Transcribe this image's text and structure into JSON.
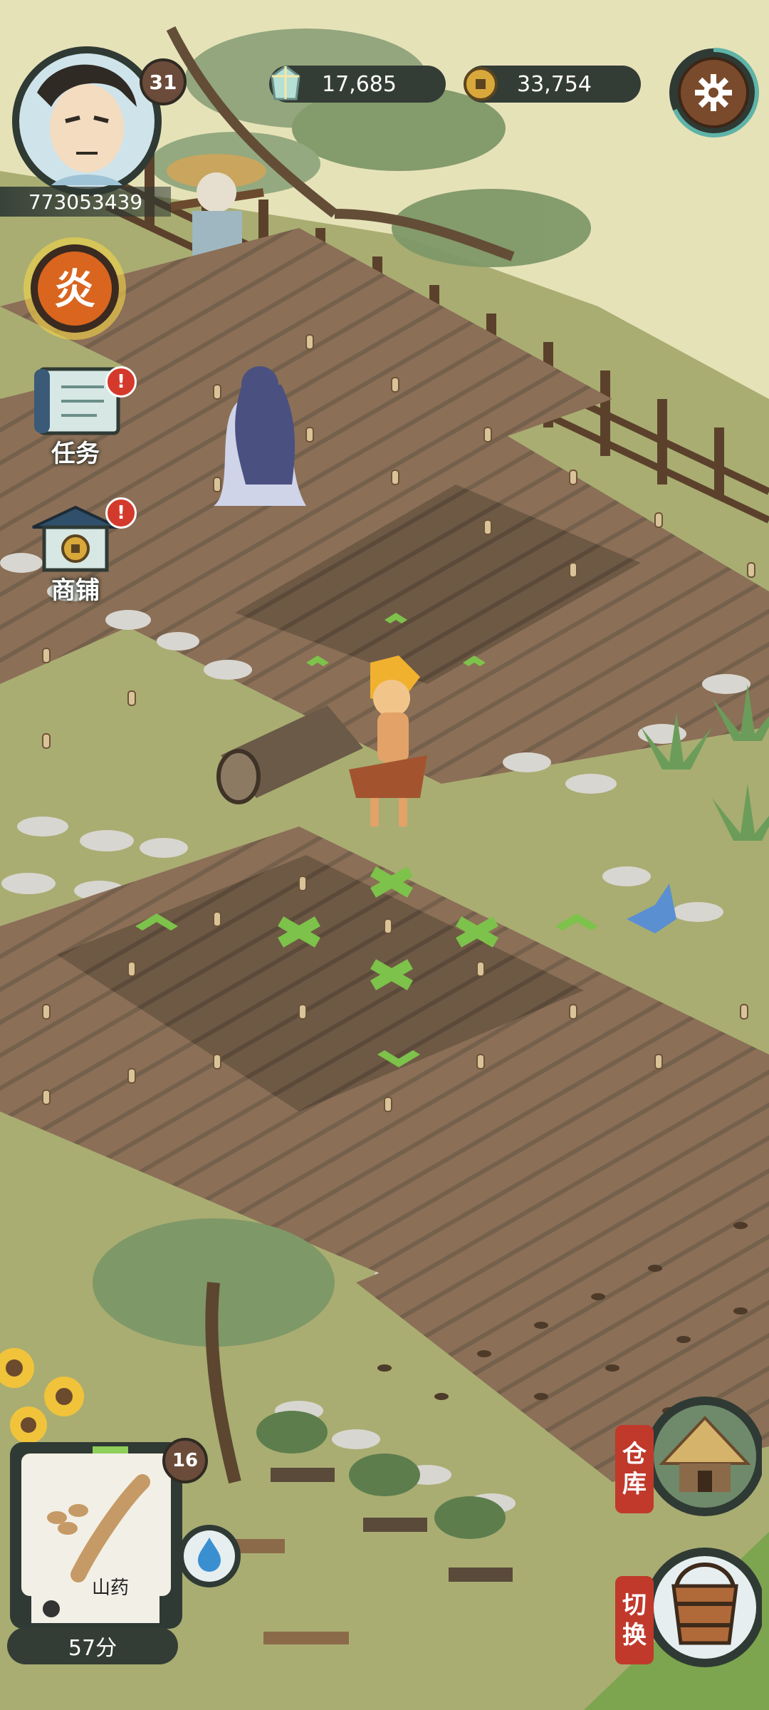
{
  "player": {
    "id": "773053439",
    "level": "31"
  },
  "currency": {
    "gems": "17,685",
    "coins": "33,754"
  },
  "skill": {
    "glyph": "炎"
  },
  "side_menu": {
    "quests": "任务",
    "shop": "商铺",
    "notice": "!"
  },
  "seed": {
    "name": "山药",
    "count": "16"
  },
  "score": "57分",
  "right_menu": {
    "warehouse_1": "仓",
    "warehouse_2": "库",
    "switch_1": "切",
    "switch_2": "换"
  },
  "colors": {
    "grass": "#a9ad72",
    "soil": "#8a6d55",
    "soil_dark": "#6a5644",
    "stone": "#d8d6d0",
    "hud_dark": "#343c36",
    "highlight": "#7dc24a",
    "badge_red": "#d43a2c"
  }
}
